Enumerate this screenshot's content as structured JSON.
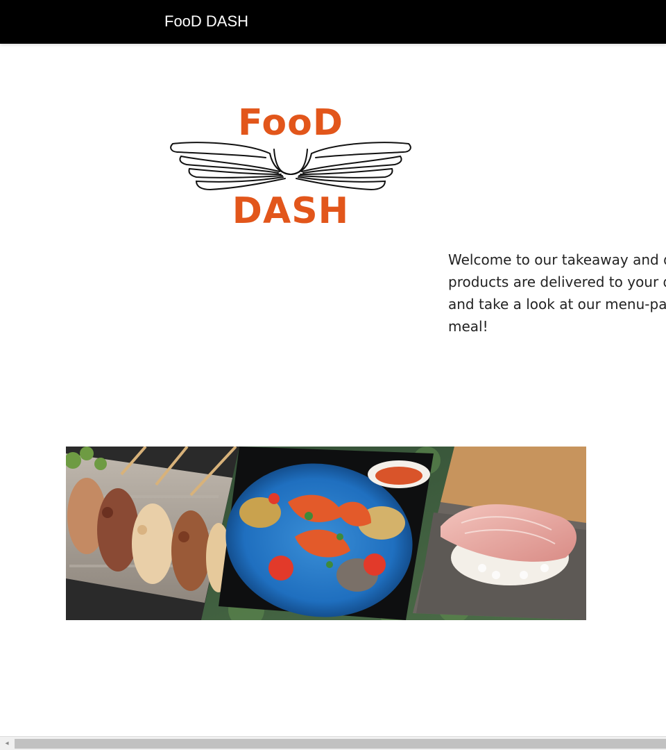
{
  "header": {
    "brand": "FooD DASH"
  },
  "logo": {
    "line1": "FooD",
    "line2": "DASH",
    "color": "#e2561b"
  },
  "welcome": {
    "lines": [
      "Welcome to our takeaway and deli",
      "products are delivered to your doo",
      "and take a look at our menu-page",
      "meal!"
    ]
  },
  "collage": {
    "photos": [
      "grilled-skewers-photo",
      "seafood-plate-photo",
      "sushi-nigiri-photo"
    ]
  },
  "scrollbar": {
    "left_arrow": "◂"
  },
  "colors": {
    "header_bg": "#000000",
    "header_text": "#ffffff",
    "accent": "#e2561b"
  }
}
